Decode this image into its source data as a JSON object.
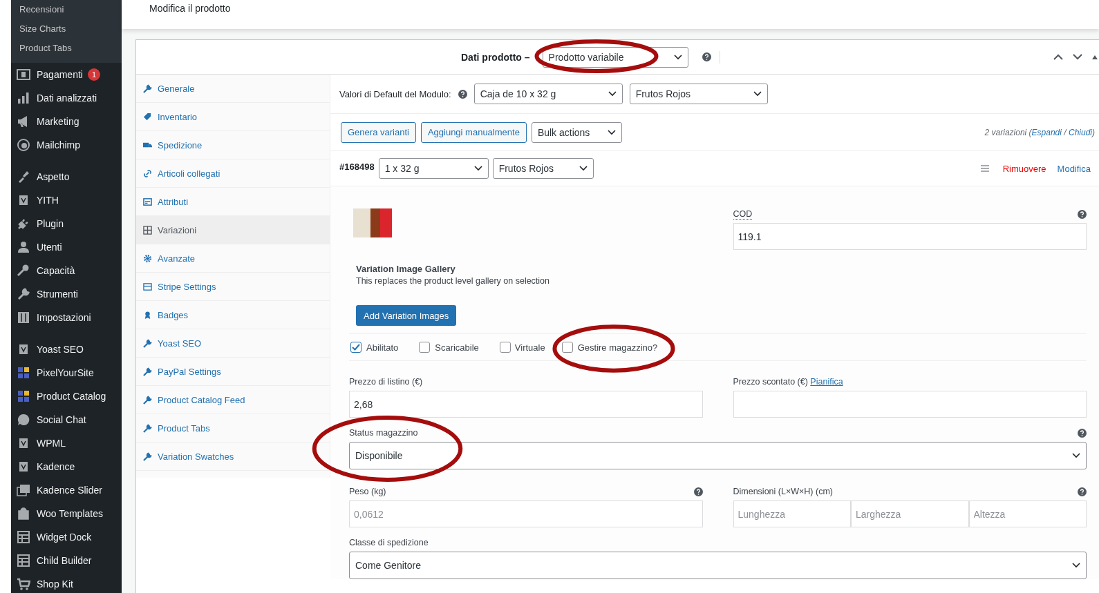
{
  "header": {
    "title": "Modifica il prodotto"
  },
  "sidebar": {
    "submenu": [
      "Recensioni",
      "Size Charts",
      "Product Tabs"
    ],
    "groups": [
      [
        {
          "label": "Pagamenti",
          "badge": "1"
        },
        {
          "label": "Dati analizzati"
        },
        {
          "label": "Marketing"
        },
        {
          "label": "Mailchimp"
        }
      ],
      [
        {
          "label": "Aspetto"
        },
        {
          "label": "YITH"
        },
        {
          "label": "Plugin"
        },
        {
          "label": "Utenti"
        },
        {
          "label": "Capacità"
        },
        {
          "label": "Strumenti"
        },
        {
          "label": "Impostazioni"
        }
      ],
      [
        {
          "label": "Yoast SEO"
        },
        {
          "label": "PixelYourSite"
        },
        {
          "label": "Product Catalog"
        },
        {
          "label": "Social Chat"
        },
        {
          "label": "WPML"
        },
        {
          "label": "Kadence"
        },
        {
          "label": "Kadence Slider"
        },
        {
          "label": "Woo Templates"
        },
        {
          "label": "Widget Dock"
        },
        {
          "label": "Child Builder"
        },
        {
          "label": "Shop Kit"
        }
      ]
    ]
  },
  "product_data": {
    "label": "Dati prodotto –",
    "product_type": {
      "value": "Prodotto variabile",
      "circled": true
    }
  },
  "tabs": [
    {
      "label": "Generale",
      "selected": false
    },
    {
      "label": "Inventario",
      "selected": false
    },
    {
      "label": "Spedizione",
      "selected": false
    },
    {
      "label": "Articoli collegati",
      "selected": false
    },
    {
      "label": "Attributi",
      "selected": false
    },
    {
      "label": "Variazioni",
      "selected": true
    },
    {
      "label": "Avanzate",
      "selected": false
    },
    {
      "label": "Stripe Settings",
      "selected": false
    },
    {
      "label": "Badges",
      "selected": false
    },
    {
      "label": "Yoast SEO",
      "selected": false
    },
    {
      "label": "PayPal Settings",
      "selected": false
    },
    {
      "label": "Product Catalog Feed",
      "selected": false
    },
    {
      "label": "Product Tabs",
      "selected": false
    },
    {
      "label": "Variation Swatches",
      "selected": false
    }
  ],
  "variations": {
    "default_label": "Valori di Default del Modulo:",
    "defaults": [
      "Caja de 10 x 32 g",
      "Frutos Rojos"
    ],
    "buttons": [
      "Genera varianti",
      "Aggiungi manualmente"
    ],
    "bulk_actions": "Bulk actions",
    "count": "2 variazioni (",
    "expand": "Espandi",
    "separator": " / ",
    "collapse": "Chiudi",
    "count_end": ")",
    "variation": {
      "id": "#168498",
      "attributes": [
        "1 x 32 g",
        "Frutos Rojos"
      ],
      "remove": "Rimuovere",
      "edit": "Modifica",
      "sku_label": "COD",
      "sku": "119.1",
      "gallery_title": "Variation Image Gallery",
      "gallery_description": "This replaces the product level gallery on selection",
      "gallery_button": "Add Variation Images",
      "options": [
        {
          "label": "Abilitato",
          "checked": true,
          "circled": false
        },
        {
          "label": "Scaricabile",
          "checked": false,
          "circled": false
        },
        {
          "label": "Virtuale",
          "checked": false,
          "circled": false
        },
        {
          "label": "Gestire magazzino?",
          "checked": false,
          "circled": true
        }
      ],
      "regular_price_label": "Prezzo di listino (€)",
      "regular_price": "2,68",
      "sale_price_label": "Prezzo scontato (€)",
      "schedule_link": "Pianifica",
      "stock_status": {
        "label": "Status magazzino",
        "value": "Disponibile",
        "circled": true
      },
      "weight": {
        "label": "Peso (kg)",
        "placeholder": "0,0612"
      },
      "dimensions": {
        "label": "Dimensioni (L×W×H) (cm)",
        "placeholders": [
          "Lunghezza",
          "Larghezza",
          "Altezza"
        ]
      },
      "shipping_class": {
        "label": "Classe di spedizione",
        "value": "Come Genitore"
      }
    }
  }
}
